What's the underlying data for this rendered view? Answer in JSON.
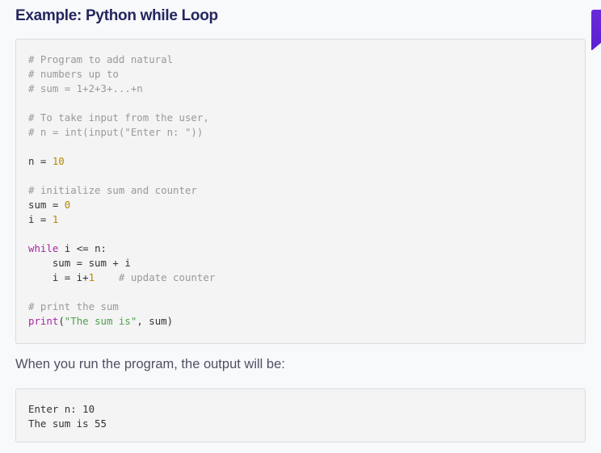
{
  "title": "Example: Python while Loop",
  "code_lines": [
    [
      [
        "c",
        "# Program to add natural"
      ]
    ],
    [
      [
        "c",
        "# numbers up to"
      ]
    ],
    [
      [
        "c",
        "# sum = 1+2+3+...+n"
      ]
    ],
    [],
    [
      [
        "c",
        "# To take input from the user,"
      ]
    ],
    [
      [
        "c",
        "# n = int(input(\"Enter n: \"))"
      ]
    ],
    [],
    [
      [
        "p",
        "n = "
      ],
      [
        "n",
        "10"
      ]
    ],
    [],
    [
      [
        "c",
        "# initialize sum and counter"
      ]
    ],
    [
      [
        "p",
        "sum = "
      ],
      [
        "n",
        "0"
      ]
    ],
    [
      [
        "p",
        "i = "
      ],
      [
        "n",
        "1"
      ]
    ],
    [],
    [
      [
        "k",
        "while"
      ],
      [
        "p",
        " i <= n:"
      ]
    ],
    [
      [
        "p",
        "    sum = sum + i"
      ]
    ],
    [
      [
        "p",
        "    i = i+"
      ],
      [
        "n",
        "1"
      ],
      [
        "p",
        "    "
      ],
      [
        "c",
        "# update counter"
      ]
    ],
    [],
    [
      [
        "c",
        "# print the sum"
      ]
    ],
    [
      [
        "k",
        "print"
      ],
      [
        "p",
        "("
      ],
      [
        "s",
        "\"The sum is\""
      ],
      [
        "p",
        ", sum)"
      ]
    ]
  ],
  "output_intro": "When you run the program, the output will be:",
  "output_lines": [
    "Enter n: 10",
    "The sum is 55"
  ],
  "colors": {
    "accent": "#6a2bd9",
    "title": "#25265e",
    "comment": "#999999",
    "keyword": "#a626a4",
    "number": "#b58900",
    "string": "#50a14f"
  }
}
